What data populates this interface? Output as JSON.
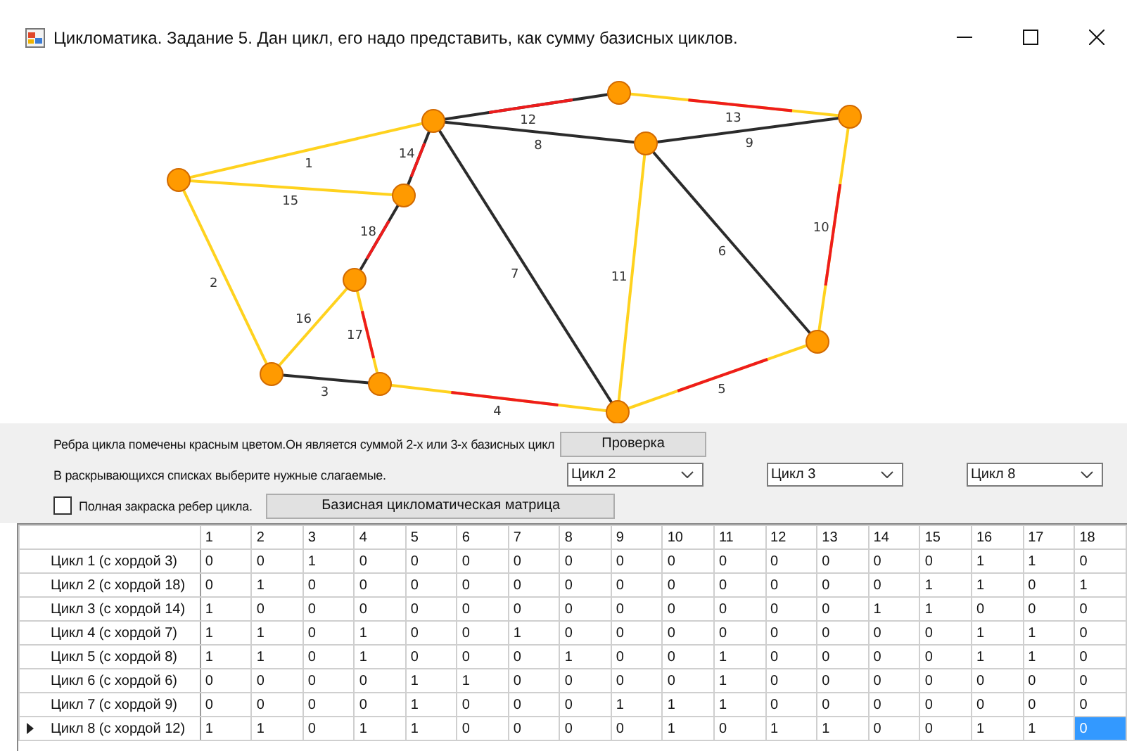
{
  "window": {
    "title": "Цикломатика. Задание 5. Дан цикл, его надо представить, как сумму базисных циклов."
  },
  "graph": {
    "edges": [
      {
        "label": "1",
        "chord": false,
        "in_cycle": false
      },
      {
        "label": "15",
        "chord": false,
        "in_cycle": false
      },
      {
        "label": "2",
        "chord": false,
        "in_cycle": false
      },
      {
        "label": "14",
        "chord": true,
        "in_cycle": true
      },
      {
        "label": "12",
        "chord": true,
        "in_cycle": true
      },
      {
        "label": "8",
        "chord": true,
        "in_cycle": false
      },
      {
        "label": "7",
        "chord": true,
        "in_cycle": false
      },
      {
        "label": "13",
        "chord": false,
        "in_cycle": true
      },
      {
        "label": "9",
        "chord": true,
        "in_cycle": false
      },
      {
        "label": "11",
        "chord": false,
        "in_cycle": false
      },
      {
        "label": "6",
        "chord": true,
        "in_cycle": false
      },
      {
        "label": "10",
        "chord": false,
        "in_cycle": true
      },
      {
        "label": "18",
        "chord": true,
        "in_cycle": true
      },
      {
        "label": "16",
        "chord": false,
        "in_cycle": false
      },
      {
        "label": "17",
        "chord": false,
        "in_cycle": true
      },
      {
        "label": "3",
        "chord": true,
        "in_cycle": false
      },
      {
        "label": "4",
        "chord": false,
        "in_cycle": true
      },
      {
        "label": "5",
        "chord": false,
        "in_cycle": true
      }
    ]
  },
  "instructions": [
    "Ребра цикла помечены красным цветом.Он является суммой 2-х или 3-х базисных цикл",
    "В раскрывающихся списках выберите нужные слагаемые."
  ],
  "check_button": "Проверка",
  "dropdowns": [
    "Цикл 2",
    "Цикл 3",
    "Цикл 8"
  ],
  "full_fill_checkbox": {
    "label": "Полная закраска ребер цикла.",
    "checked": false
  },
  "matrix_button": "Базисная цикломатическая матрица",
  "table": {
    "columns": [
      "1",
      "2",
      "3",
      "4",
      "5",
      "6",
      "7",
      "8",
      "9",
      "10",
      "11",
      "12",
      "13",
      "14",
      "15",
      "16",
      "17",
      "18"
    ],
    "rows": [
      {
        "label": "Цикл 1 (с хордой 3)",
        "current": false,
        "cells": [
          {
            "v": "0",
            "selected": false
          },
          {
            "v": "0",
            "selected": false
          },
          {
            "v": "1",
            "selected": false
          },
          {
            "v": "0",
            "selected": false
          },
          {
            "v": "0",
            "selected": false
          },
          {
            "v": "0",
            "selected": false
          },
          {
            "v": "0",
            "selected": false
          },
          {
            "v": "0",
            "selected": false
          },
          {
            "v": "0",
            "selected": false
          },
          {
            "v": "0",
            "selected": false
          },
          {
            "v": "0",
            "selected": false
          },
          {
            "v": "0",
            "selected": false
          },
          {
            "v": "0",
            "selected": false
          },
          {
            "v": "0",
            "selected": false
          },
          {
            "v": "0",
            "selected": false
          },
          {
            "v": "1",
            "selected": false
          },
          {
            "v": "1",
            "selected": false
          },
          {
            "v": "0",
            "selected": false
          }
        ]
      },
      {
        "label": "Цикл 2 (с хордой 18)",
        "current": false,
        "cells": [
          {
            "v": "0",
            "selected": false
          },
          {
            "v": "1",
            "selected": false
          },
          {
            "v": "0",
            "selected": false
          },
          {
            "v": "0",
            "selected": false
          },
          {
            "v": "0",
            "selected": false
          },
          {
            "v": "0",
            "selected": false
          },
          {
            "v": "0",
            "selected": false
          },
          {
            "v": "0",
            "selected": false
          },
          {
            "v": "0",
            "selected": false
          },
          {
            "v": "0",
            "selected": false
          },
          {
            "v": "0",
            "selected": false
          },
          {
            "v": "0",
            "selected": false
          },
          {
            "v": "0",
            "selected": false
          },
          {
            "v": "0",
            "selected": false
          },
          {
            "v": "1",
            "selected": false
          },
          {
            "v": "1",
            "selected": false
          },
          {
            "v": "0",
            "selected": false
          },
          {
            "v": "1",
            "selected": false
          }
        ]
      },
      {
        "label": "Цикл 3 (с хордой 14)",
        "current": false,
        "cells": [
          {
            "v": "1",
            "selected": false
          },
          {
            "v": "0",
            "selected": false
          },
          {
            "v": "0",
            "selected": false
          },
          {
            "v": "0",
            "selected": false
          },
          {
            "v": "0",
            "selected": false
          },
          {
            "v": "0",
            "selected": false
          },
          {
            "v": "0",
            "selected": false
          },
          {
            "v": "0",
            "selected": false
          },
          {
            "v": "0",
            "selected": false
          },
          {
            "v": "0",
            "selected": false
          },
          {
            "v": "0",
            "selected": false
          },
          {
            "v": "0",
            "selected": false
          },
          {
            "v": "0",
            "selected": false
          },
          {
            "v": "1",
            "selected": false
          },
          {
            "v": "1",
            "selected": false
          },
          {
            "v": "0",
            "selected": false
          },
          {
            "v": "0",
            "selected": false
          },
          {
            "v": "0",
            "selected": false
          }
        ]
      },
      {
        "label": "Цикл 4 (с хордой 7)",
        "current": false,
        "cells": [
          {
            "v": "1",
            "selected": false
          },
          {
            "v": "1",
            "selected": false
          },
          {
            "v": "0",
            "selected": false
          },
          {
            "v": "1",
            "selected": false
          },
          {
            "v": "0",
            "selected": false
          },
          {
            "v": "0",
            "selected": false
          },
          {
            "v": "1",
            "selected": false
          },
          {
            "v": "0",
            "selected": false
          },
          {
            "v": "0",
            "selected": false
          },
          {
            "v": "0",
            "selected": false
          },
          {
            "v": "0",
            "selected": false
          },
          {
            "v": "0",
            "selected": false
          },
          {
            "v": "0",
            "selected": false
          },
          {
            "v": "0",
            "selected": false
          },
          {
            "v": "0",
            "selected": false
          },
          {
            "v": "1",
            "selected": false
          },
          {
            "v": "1",
            "selected": false
          },
          {
            "v": "0",
            "selected": false
          }
        ]
      },
      {
        "label": "Цикл 5 (с хордой 8)",
        "current": false,
        "cells": [
          {
            "v": "1",
            "selected": false
          },
          {
            "v": "1",
            "selected": false
          },
          {
            "v": "0",
            "selected": false
          },
          {
            "v": "1",
            "selected": false
          },
          {
            "v": "0",
            "selected": false
          },
          {
            "v": "0",
            "selected": false
          },
          {
            "v": "0",
            "selected": false
          },
          {
            "v": "1",
            "selected": false
          },
          {
            "v": "0",
            "selected": false
          },
          {
            "v": "0",
            "selected": false
          },
          {
            "v": "1",
            "selected": false
          },
          {
            "v": "0",
            "selected": false
          },
          {
            "v": "0",
            "selected": false
          },
          {
            "v": "0",
            "selected": false
          },
          {
            "v": "0",
            "selected": false
          },
          {
            "v": "1",
            "selected": false
          },
          {
            "v": "1",
            "selected": false
          },
          {
            "v": "0",
            "selected": false
          }
        ]
      },
      {
        "label": "Цикл 6 (с хордой 6)",
        "current": false,
        "cells": [
          {
            "v": "0",
            "selected": false
          },
          {
            "v": "0",
            "selected": false
          },
          {
            "v": "0",
            "selected": false
          },
          {
            "v": "0",
            "selected": false
          },
          {
            "v": "1",
            "selected": false
          },
          {
            "v": "1",
            "selected": false
          },
          {
            "v": "0",
            "selected": false
          },
          {
            "v": "0",
            "selected": false
          },
          {
            "v": "0",
            "selected": false
          },
          {
            "v": "0",
            "selected": false
          },
          {
            "v": "1",
            "selected": false
          },
          {
            "v": "0",
            "selected": false
          },
          {
            "v": "0",
            "selected": false
          },
          {
            "v": "0",
            "selected": false
          },
          {
            "v": "0",
            "selected": false
          },
          {
            "v": "0",
            "selected": false
          },
          {
            "v": "0",
            "selected": false
          },
          {
            "v": "0",
            "selected": false
          }
        ]
      },
      {
        "label": "Цикл 7 (с хордой 9)",
        "current": false,
        "cells": [
          {
            "v": "0",
            "selected": false
          },
          {
            "v": "0",
            "selected": false
          },
          {
            "v": "0",
            "selected": false
          },
          {
            "v": "0",
            "selected": false
          },
          {
            "v": "1",
            "selected": false
          },
          {
            "v": "0",
            "selected": false
          },
          {
            "v": "0",
            "selected": false
          },
          {
            "v": "0",
            "selected": false
          },
          {
            "v": "1",
            "selected": false
          },
          {
            "v": "1",
            "selected": false
          },
          {
            "v": "1",
            "selected": false
          },
          {
            "v": "0",
            "selected": false
          },
          {
            "v": "0",
            "selected": false
          },
          {
            "v": "0",
            "selected": false
          },
          {
            "v": "0",
            "selected": false
          },
          {
            "v": "0",
            "selected": false
          },
          {
            "v": "0",
            "selected": false
          },
          {
            "v": "0",
            "selected": false
          }
        ]
      },
      {
        "label": "Цикл 8 (с хордой 12)",
        "current": true,
        "cells": [
          {
            "v": "1",
            "selected": false
          },
          {
            "v": "1",
            "selected": false
          },
          {
            "v": "0",
            "selected": false
          },
          {
            "v": "1",
            "selected": false
          },
          {
            "v": "1",
            "selected": false
          },
          {
            "v": "0",
            "selected": false
          },
          {
            "v": "0",
            "selected": false
          },
          {
            "v": "0",
            "selected": false
          },
          {
            "v": "0",
            "selected": false
          },
          {
            "v": "1",
            "selected": false
          },
          {
            "v": "0",
            "selected": false
          },
          {
            "v": "1",
            "selected": false
          },
          {
            "v": "1",
            "selected": false
          },
          {
            "v": "0",
            "selected": false
          },
          {
            "v": "0",
            "selected": false
          },
          {
            "v": "1",
            "selected": false
          },
          {
            "v": "1",
            "selected": false
          },
          {
            "v": "0",
            "selected": true
          }
        ]
      }
    ]
  }
}
